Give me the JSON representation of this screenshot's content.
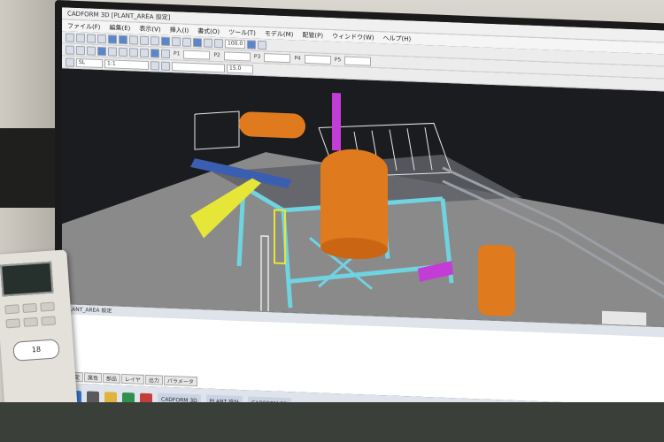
{
  "window": {
    "title": "CADFORM 3D [PLANT_AREA 設定]"
  },
  "menubar": {
    "items": [
      "ファイル(F)",
      "編集(E)",
      "表示(V)",
      "挿入(I)",
      "書式(O)",
      "ツール(T)",
      "モデル(M)",
      "配管(P)",
      "ウィンドウ(W)",
      "ヘルプ(H)"
    ]
  },
  "toolbar_values": {
    "zoom": "100.0",
    "scale": "1:1",
    "layer": "SL",
    "height": "15.0",
    "p_labels": [
      "P1",
      "P2",
      "P3",
      "P4",
      "P5"
    ]
  },
  "lower_panel": {
    "title": "PLANT_AREA 設定",
    "tabs": [
      "設定",
      "属性",
      "部品",
      "レイヤ",
      "出力",
      "パラメータ"
    ]
  },
  "taskbar": {
    "items": [
      "CADFORM 3D",
      "PLANT 設計",
      "CADFORM 3D"
    ]
  },
  "sticker": {
    "text": "18"
  },
  "colors": {
    "vessel": "#e07a1f",
    "frame": "#6fd3e0",
    "railing": "#e8e8e8",
    "stair": "#e6e639",
    "motor": "#c43cd6",
    "floor": "#8c8c8c",
    "viewport_bg": "#1b1c1f"
  }
}
